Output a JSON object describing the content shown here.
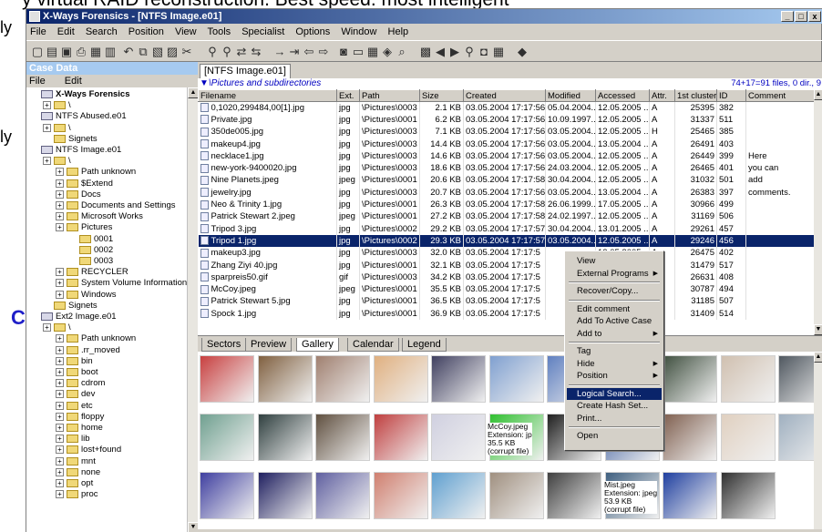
{
  "background": {
    "top_line": "y virtual RAID reconstruction. Best speed. most intelligent",
    "side_letters": [
      "ly",
      "ly"
    ],
    "side_c": "C"
  },
  "window": {
    "title": "X-Ways Forensics - [NTFS Image.e01]",
    "controls": [
      "_",
      "□",
      "x"
    ]
  },
  "menubar": [
    "File",
    "Edit",
    "Search",
    "Position",
    "View",
    "Tools",
    "Specialist",
    "Options",
    "Window",
    "Help"
  ],
  "toolbar_icons": [
    "new-icon",
    "open-icon",
    "save-icon",
    "print-icon",
    "properties-icon",
    "case-icon",
    "undo-icon",
    "copy-icon",
    "paste-icon",
    "paste-special-icon",
    "cut-icon",
    "find-icon",
    "find-hex-icon",
    "replace-icon",
    "replace-hex-icon",
    "goto-offset-icon",
    "goto-sector-icon",
    "back-icon",
    "forward-icon",
    "disk-icon",
    "ram-icon",
    "calculator-icon",
    "hash-icon",
    "search-icon",
    "gallery-icon",
    "prev-icon",
    "next-icon",
    "find-file-icon",
    "camera-icon",
    "table-icon",
    "help-icon"
  ],
  "case": {
    "header": "Case Data",
    "menu": [
      "File",
      "Edit"
    ],
    "tree": [
      {
        "label": "X-Ways Forensics",
        "level": 0,
        "bold": true
      },
      {
        "label": "\\",
        "level": 1
      },
      {
        "label": "NTFS Abused.e01",
        "level": 0
      },
      {
        "label": "\\",
        "level": 1
      },
      {
        "label": "Signets",
        "level": 1
      },
      {
        "label": "NTFS Image.e01",
        "level": 0
      },
      {
        "label": "\\",
        "level": 1
      },
      {
        "label": "Path unknown",
        "level": 2
      },
      {
        "label": "$Extend",
        "level": 2
      },
      {
        "label": "Docs",
        "level": 2
      },
      {
        "label": "Documents and Settings",
        "level": 2
      },
      {
        "label": "Microsoft Works",
        "level": 2
      },
      {
        "label": "Pictures",
        "level": 2
      },
      {
        "label": "0001",
        "level": 3
      },
      {
        "label": "0002",
        "level": 3
      },
      {
        "label": "0003",
        "level": 3
      },
      {
        "label": "RECYCLER",
        "level": 2
      },
      {
        "label": "System Volume Information",
        "level": 2
      },
      {
        "label": "Windows",
        "level": 2
      },
      {
        "label": "Signets",
        "level": 1
      },
      {
        "label": "Ext2 Image.e01",
        "level": 0
      },
      {
        "label": "\\",
        "level": 1
      },
      {
        "label": "Path unknown",
        "level": 2
      },
      {
        "label": ".rr_moved",
        "level": 2
      },
      {
        "label": "bin",
        "level": 2
      },
      {
        "label": "boot",
        "level": 2
      },
      {
        "label": "cdrom",
        "level": 2
      },
      {
        "label": "dev",
        "level": 2
      },
      {
        "label": "etc",
        "level": 2
      },
      {
        "label": "floppy",
        "level": 2
      },
      {
        "label": "home",
        "level": 2
      },
      {
        "label": "lib",
        "level": 2
      },
      {
        "label": "lost+found",
        "level": 2
      },
      {
        "label": "mnt",
        "level": 2
      },
      {
        "label": "none",
        "level": 2
      },
      {
        "label": "opt",
        "level": 2
      },
      {
        "label": "proc",
        "level": 2
      }
    ]
  },
  "tab": "[NTFS Image.e01]",
  "pathbar": {
    "path": "\\Pictures and subdirectories",
    "count": "74+17=91 files, 0 dir., 9"
  },
  "columns": [
    "Filename",
    "Ext.",
    "Path",
    "Size",
    "Created",
    "Modified",
    "Accessed",
    "Attr.",
    "1st cluster",
    "ID",
    "Comment"
  ],
  "files": [
    [
      "0,1020,299484,00[1].jpg",
      "jpg",
      "\\Pictures\\0003",
      "2.1 KB",
      "03.05.2004  17:17:56",
      "05.04.2004...",
      "12.05.2005 ...",
      "A",
      "25395",
      "382",
      ""
    ],
    [
      "Private.jpg",
      "jpg",
      "\\Pictures\\0001",
      "6.2 KB",
      "03.05.2004  17:17:56",
      "10.09.1997...",
      "12.05.2005 ...",
      "A",
      "31337",
      "511",
      ""
    ],
    [
      "350de005.jpg",
      "jpg",
      "\\Pictures\\0003",
      "7.1 KB",
      "03.05.2004  17:17:56",
      "03.05.2004...",
      "12.05.2005 ...",
      "H",
      "25465",
      "385",
      ""
    ],
    [
      "makeup4.jpg",
      "jpg",
      "\\Pictures\\0003",
      "14.4 KB",
      "03.05.2004  17:17:56",
      "03.05.2004...",
      "13.05.2004 ...",
      "A",
      "26491",
      "403",
      ""
    ],
    [
      "necklace1.jpg",
      "jpg",
      "\\Pictures\\0003",
      "14.6 KB",
      "03.05.2004  17:17:56",
      "03.05.2004...",
      "12.05.2005 ...",
      "A",
      "26449",
      "399",
      "Here"
    ],
    [
      "new-york-9400020.jpg",
      "jpg",
      "\\Pictures\\0003",
      "18.6 KB",
      "03.05.2004  17:17:56",
      "24.03.2004...",
      "12.05.2005 ...",
      "A",
      "26465",
      "401",
      "you can"
    ],
    [
      "Nine Planets.jpeg",
      "jpeg",
      "\\Pictures\\0001",
      "20.6 KB",
      "03.05.2004  17:17:58",
      "30.04.2004...",
      "12.05.2005 ...",
      "A",
      "31032",
      "501",
      "add"
    ],
    [
      "jewelry.jpg",
      "jpg",
      "\\Pictures\\0003",
      "20.7 KB",
      "03.05.2004  17:17:56",
      "03.05.2004...",
      "13.05.2004 ...",
      "A",
      "26383",
      "397",
      "comments."
    ],
    [
      "Neo & Trinity 1.jpg",
      "jpg",
      "\\Pictures\\0001",
      "26.3 KB",
      "03.05.2004  17:17:58",
      "26.06.1999...",
      "17.05.2005 ...",
      "A",
      "30966",
      "499",
      ""
    ],
    [
      "Patrick Stewart 2.jpeg",
      "jpeg",
      "\\Pictures\\0001",
      "27.2 KB",
      "03.05.2004  17:17:58",
      "24.02.1997...",
      "12.05.2005 ...",
      "A",
      "31169",
      "506",
      ""
    ],
    [
      "Tripod 3.jpg",
      "jpg",
      "\\Pictures\\0002",
      "29.2 KB",
      "03.05.2004  17:17:57",
      "30.04.2004...",
      "13.01.2005 ...",
      "A",
      "29261",
      "457",
      ""
    ],
    [
      "Tripod 1.jpg",
      "jpg",
      "\\Pictures\\0002",
      "29.3 KB",
      "03.05.2004  17:17:57",
      "03.05.2004...",
      "12.05.2005 ...",
      "A",
      "29246",
      "456",
      ""
    ],
    [
      "makeup3.jpg",
      "jpg",
      "\\Pictures\\0003",
      "32.0 KB",
      "03.05.2004  17:17:5",
      "",
      "12.05.2005 ...",
      "A",
      "26475",
      "402",
      ""
    ],
    [
      "Zhang Ziyi 40.jpg",
      "jpg",
      "\\Pictures\\0001",
      "32.1 KB",
      "03.05.2004  17:17:5",
      "",
      "12.05.2005 ...",
      "A",
      "31479",
      "517",
      ""
    ],
    [
      "sparpreis50.gif",
      "gif",
      "\\Pictures\\0003",
      "34.2 KB",
      "03.05.2004  17:17:5",
      "",
      "12.05.2005 ...",
      "A",
      "26631",
      "408",
      ""
    ],
    [
      "McCoy.jpeg",
      "jpeg",
      "\\Pictures\\0001",
      "35.5 KB",
      "03.05.2004  17:17:5",
      "",
      "12.05.2005 ...",
      "A",
      "30787",
      "494",
      ""
    ],
    [
      "Patrick Stewart 5.jpg",
      "jpg",
      "\\Pictures\\0001",
      "36.5 KB",
      "03.05.2004  17:17:5",
      "",
      "12.05.2005 ...",
      "A",
      "31185",
      "507",
      ""
    ],
    [
      "Spock 1.jpg",
      "jpg",
      "\\Pictures\\0001",
      "36.9 KB",
      "03.05.2004  17:17:5",
      "",
      "12.05.2005 ...",
      "A",
      "31409",
      "514",
      ""
    ]
  ],
  "selected_row": 11,
  "bottom_tabs": [
    "Sectors",
    "Preview",
    "Gallery",
    "Calendar",
    "Legend"
  ],
  "active_bottom_tab": "Gallery",
  "gallery_captions": [
    {
      "name": "McCoy.jpeg",
      "ext": "Extension: jp",
      "size": "35.5 KB",
      "note": "(corrupt file)"
    },
    {
      "name": "Mist.jpeg",
      "ext": "Extension: jpeg",
      "size": "53.9 KB",
      "note": "(corrupt file)"
    }
  ],
  "context_menu": [
    {
      "label": "View"
    },
    {
      "label": "External Programs",
      "submenu": true
    },
    {
      "sep": true
    },
    {
      "label": "Recover/Copy..."
    },
    {
      "sep": true
    },
    {
      "label": "Edit comment"
    },
    {
      "label": "Add To Active Case"
    },
    {
      "label": "Add to",
      "submenu": true
    },
    {
      "sep": true
    },
    {
      "label": "Tag"
    },
    {
      "label": "Hide",
      "submenu": true
    },
    {
      "label": "Position",
      "submenu": true
    },
    {
      "sep": true
    },
    {
      "label": "Logical Search...",
      "highlight": true
    },
    {
      "label": "Create Hash Set..."
    },
    {
      "label": "Print..."
    },
    {
      "sep": true
    },
    {
      "label": "Open"
    }
  ],
  "colors": {
    "title_start": "#0a246a",
    "title_end": "#a6caf0",
    "selection": "#0a246a",
    "path_text": "#0000c0"
  }
}
